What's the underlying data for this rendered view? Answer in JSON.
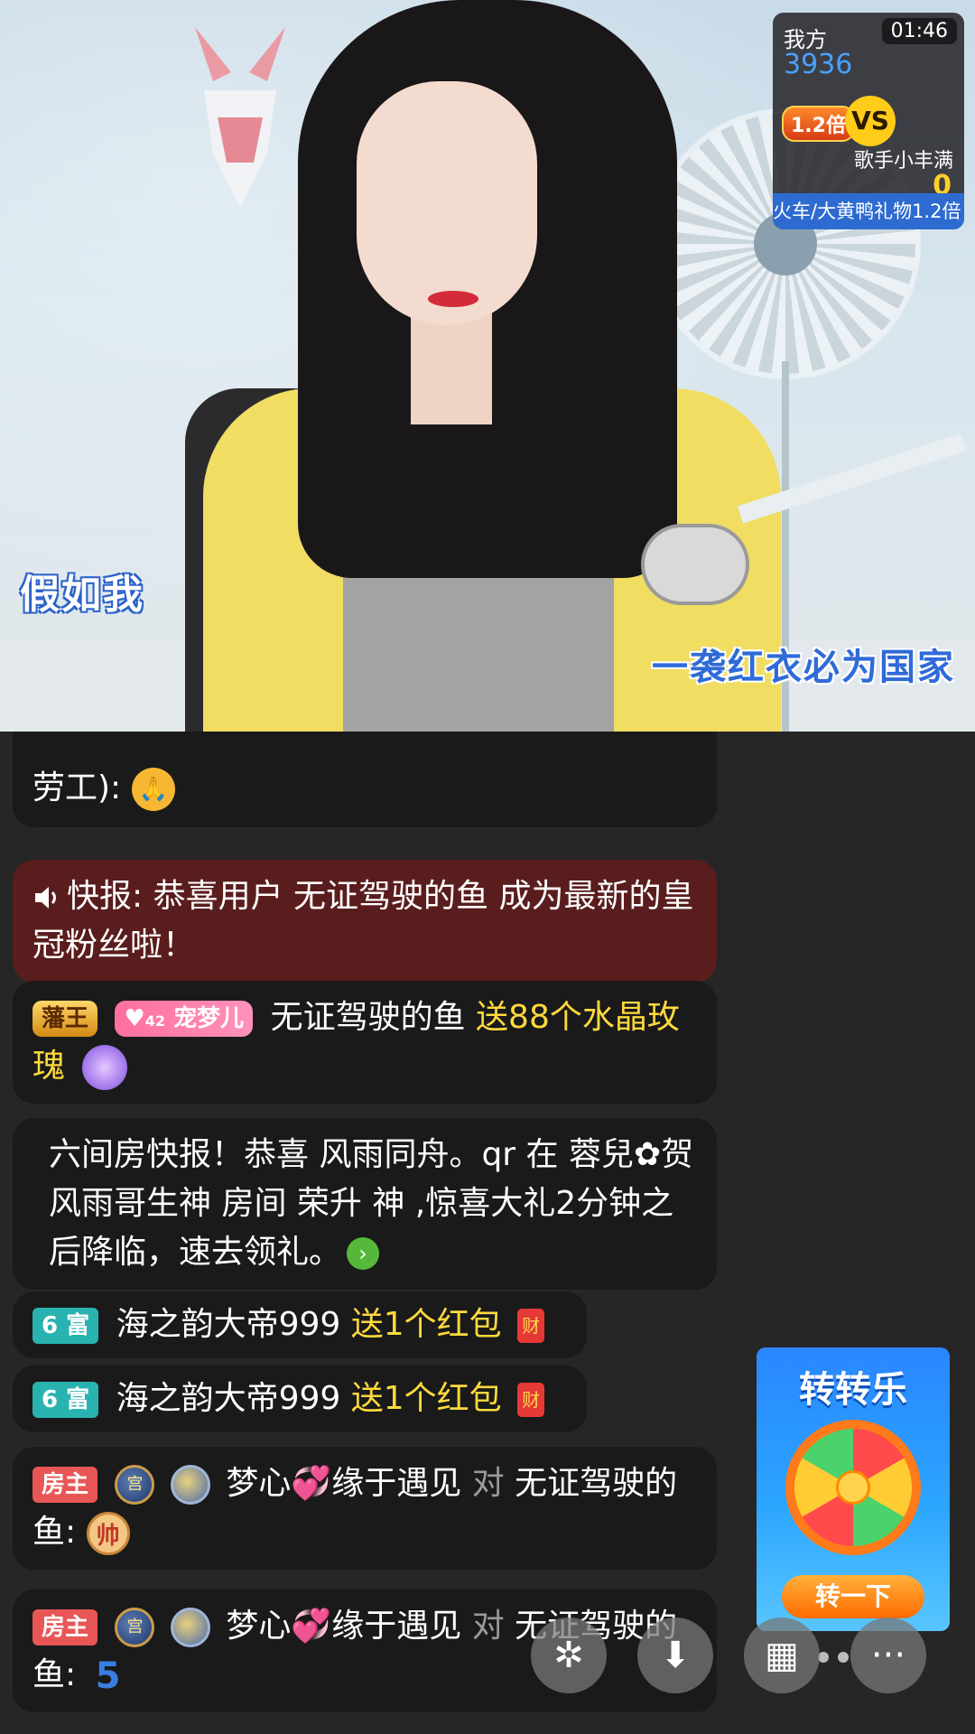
{
  "video": {
    "lyric_left": "假如我",
    "lyric_right": "一袭红衣必为国家"
  },
  "pk": {
    "timer": "01:46",
    "our_side_label": "我方",
    "our_score": "3936",
    "multiplier": "1.2倍",
    "vs": "VS",
    "opponent_name": "歌手小丰满",
    "opponent_score": "0",
    "bottom_text": "火车/大黄鸭礼物1.2倍"
  },
  "chat": [
    {
      "type": "partial",
      "text": "劳工):",
      "emoji": "pray-emoji"
    },
    {
      "type": "announce",
      "text": "快报: 恭喜用户 无证驾驶的鱼 成为最新的皇冠粉丝啦！"
    },
    {
      "type": "gift",
      "badge1": "藩王",
      "badge2": "宠梦儿",
      "badge2_level": "42",
      "user": "无证驾驶的鱼",
      "action": "送88个水晶玫瑰"
    },
    {
      "type": "system",
      "text": "六间房快报！恭喜 风雨同舟。qr 在 蓉兒✿贺风雨哥生神 房间 荣升 神 ,惊喜大礼2分钟之后降临，速去领礼。"
    },
    {
      "type": "gift",
      "badge": "6 富",
      "user": "海之韵大帝999",
      "action": "送1个红包",
      "icon": "财"
    },
    {
      "type": "gift",
      "badge": "6 富",
      "user": "海之韵大帝999",
      "action": "送1个红包",
      "icon": "财"
    },
    {
      "type": "say",
      "badge": "房主",
      "icon1": "宫",
      "user_a": "梦心",
      "user_b": "缘于遇见",
      "to": "对",
      "target": "无证驾驶的鱼:",
      "emoji": "帅"
    },
    {
      "type": "say",
      "badge": "房主",
      "icon1": "宫",
      "user_a": "梦心",
      "user_b": "缘于遇见",
      "to": "对",
      "target": "无证驾驶的鱼:",
      "emoji": "5"
    }
  ],
  "game": {
    "title": "转转乐",
    "button": "转一下"
  },
  "buttons": {
    "share": "✲",
    "download": "⬇",
    "apps": "▦",
    "more": "···"
  }
}
